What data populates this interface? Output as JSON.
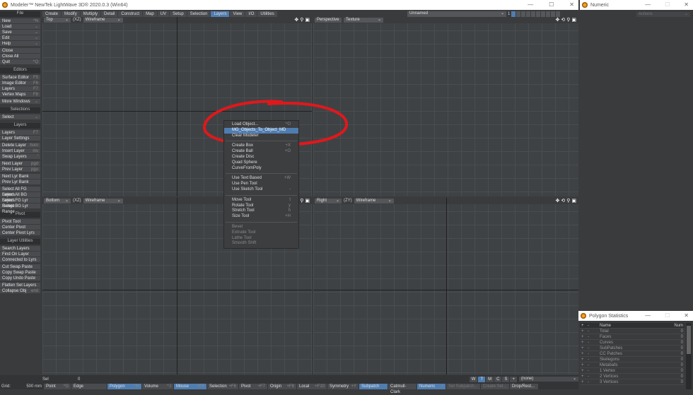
{
  "window": {
    "title": "Modeler™ NewTek LightWave 3D® 2020.0.3 (Win64)",
    "minimize": "—",
    "maximize": "☐",
    "close": "✕"
  },
  "tabs": [
    "Create",
    "Modify",
    "Multiply",
    "Detail",
    "Construct",
    "Map",
    "UV",
    "Setup",
    "Selection",
    "Layers",
    "View",
    "I/O",
    "Utilities"
  ],
  "active_tab": "Layers",
  "layer_bar": {
    "object": "Unnamed",
    "layer_num": "1"
  },
  "sidebar": [
    {
      "header": "File",
      "blocks": [
        [
          {
            "l": "New",
            "s": "^N"
          },
          {
            "l": "Load",
            "s": "⌄"
          },
          {
            "l": "Save",
            "s": "⌄"
          },
          {
            "l": "Edit",
            "s": "⌄"
          },
          {
            "l": "Help",
            "s": "⌄"
          }
        ],
        [
          {
            "l": "Close",
            "s": ""
          },
          {
            "l": "Close All",
            "s": ""
          },
          {
            "l": "Quit",
            "s": "^Q"
          }
        ]
      ]
    },
    {
      "header": "Editors",
      "blocks": [
        [
          {
            "l": "Surface Editor",
            "s": "F5"
          },
          {
            "l": "Image Editor",
            "s": "F6"
          },
          {
            "l": "Layers",
            "s": "F7"
          },
          {
            "l": "Vertex Maps",
            "s": "F8"
          }
        ],
        [
          {
            "l": "More Windows",
            "s": "⌄"
          }
        ]
      ]
    },
    {
      "header": "Selections",
      "blocks": [
        [
          {
            "l": "Select",
            "s": "⌄"
          }
        ]
      ]
    },
    {
      "header": "Layers",
      "blocks": [
        [
          {
            "l": "Layers",
            "s": "F7"
          },
          {
            "l": "Layer Settings",
            "s": ""
          }
        ],
        [
          {
            "l": "Delete Layer",
            "s": "hom"
          },
          {
            "l": "Insert Layer",
            "s": "ins"
          },
          {
            "l": "Swap Layers",
            "s": "'"
          }
        ],
        [
          {
            "l": "Next Layer",
            "s": "pgd"
          },
          {
            "l": "Prev Layer",
            "s": "pgu"
          }
        ],
        [
          {
            "l": "Next Lyr Bank",
            "s": ""
          },
          {
            "l": "Prev Lyr Bank",
            "s": ""
          }
        ],
        [
          {
            "l": "Select All FG Layers",
            "s": ""
          },
          {
            "l": "Select All BG Layers",
            "s": ""
          },
          {
            "l": "Select FG Lyr Range",
            "s": ""
          },
          {
            "l": "Select BG Lyr Range",
            "s": ""
          }
        ]
      ]
    },
    {
      "header": "Pivot",
      "blocks": [
        [
          {
            "l": "Pivot Tool",
            "s": ""
          },
          {
            "l": "Center Pivot",
            "s": ""
          },
          {
            "l": "Center Pivot Lyrs",
            "s": ""
          }
        ]
      ]
    },
    {
      "header": "Layer Utilities",
      "blocks": [
        [
          {
            "l": "Search Layers",
            "s": ""
          },
          {
            "l": "Find On Layer",
            "s": ""
          },
          {
            "l": "Connected to Lyrs",
            "s": ""
          }
        ],
        [
          {
            "l": "Cut Swap Paste",
            "s": ""
          },
          {
            "l": "Copy Swap Paste",
            "s": ""
          },
          {
            "l": "Copy Undo Paste",
            "s": ""
          }
        ],
        [
          {
            "l": "Flatten Sel Layers",
            "s": ""
          },
          {
            "l": "Collapse Obj",
            "s": "end"
          }
        ]
      ]
    }
  ],
  "viewports": [
    {
      "view": "Top",
      "axis": "(XZ)",
      "mode": "Wireframe"
    },
    {
      "view": "Perspective",
      "axis": "",
      "mode": "Texture"
    },
    {
      "view": "Bottom",
      "axis": "(XZ)",
      "mode": "Wireframe"
    },
    {
      "view": "Right",
      "axis": "(ZY)",
      "mode": "Wireframe"
    }
  ],
  "context_menu": [
    [
      {
        "l": "Load Object...",
        "s": "^O"
      },
      {
        "l": "MG_Objects_To_Object_MD",
        "s": "",
        "hl": true
      },
      {
        "l": "Clear Modeler",
        "s": ""
      }
    ],
    [
      {
        "l": "Create Box",
        "s": "+X"
      },
      {
        "l": "Create Ball",
        "s": "+O"
      },
      {
        "l": "Create Disc",
        "s": ""
      },
      {
        "l": "Quad Sphere",
        "s": ""
      },
      {
        "l": "CurveFromPoly",
        "s": ""
      }
    ],
    [
      {
        "l": "Use Text Based",
        "s": "+W"
      },
      {
        "l": "Use Pen Tool",
        "s": ""
      },
      {
        "l": "Use Sketch Tool",
        "s": "-"
      }
    ],
    [
      {
        "l": "Move Tool",
        "s": "t"
      },
      {
        "l": "Rotate Tool",
        "s": "y"
      },
      {
        "l": "Stretch Tool",
        "s": "h"
      },
      {
        "l": "Size Tool",
        "s": "+H"
      }
    ],
    [
      {
        "l": "Bevel",
        "s": "",
        "dim": true
      },
      {
        "l": "Extrude Tool",
        "s": "",
        "dim": true
      },
      {
        "l": "Lathe Tool",
        "s": "",
        "dim": true
      },
      {
        "l": "Smooth Shift",
        "s": "",
        "dim": true
      }
    ]
  ],
  "status": {
    "sel_label": "Sel",
    "sel_value": "0",
    "grid_label": "Grid:",
    "grid_value": "500 mm",
    "wtmcs": [
      "W",
      "T",
      "M",
      "C",
      "S",
      "+"
    ],
    "wtmcs_active": "T",
    "layer_select": "(none)",
    "buttons": [
      {
        "l": "Point",
        "s": "^G"
      },
      {
        "l": "Edge",
        "s": ""
      },
      {
        "l": "Polygon",
        "s": "^H",
        "on": true
      },
      {
        "l": "Volume",
        "s": "^J"
      },
      {
        "l": "Mouse",
        "s": "+F5",
        "on": true
      },
      {
        "l": "Selection",
        "s": "+F6"
      },
      {
        "l": "Pivot",
        "s": "+F7"
      },
      {
        "l": "Origin",
        "s": "+F8"
      },
      {
        "l": "Local",
        "s": "+F10"
      },
      {
        "l": "Symmetry",
        "s": "+Y"
      },
      {
        "l": "Subpatch",
        "s": "",
        "on": true
      },
      {
        "l": "Catmull-Clark",
        "s": ""
      },
      {
        "l": "Numeric",
        "s": "n",
        "on": true
      },
      {
        "l": "Set Subpatch...",
        "s": "",
        "dim": true
      },
      {
        "l": "Create Sel...",
        "s": "",
        "dim": true
      },
      {
        "l": "Drop/Rest...",
        "s": ""
      }
    ]
  },
  "numeric_panel": {
    "title": "Numeric",
    "actions": "Actions"
  },
  "poly_stats": {
    "title": "Polygon Statistics",
    "col_name": "Name",
    "col_num": "Num",
    "rows": [
      {
        "n": "Total",
        "v": "0"
      },
      {
        "n": "Faces",
        "v": "0"
      },
      {
        "n": "Curves",
        "v": "0"
      },
      {
        "n": "SubPatches",
        "v": "0"
      },
      {
        "n": "CC Patches",
        "v": "0"
      },
      {
        "n": "Skelegons",
        "v": "0"
      },
      {
        "n": "Metaballs",
        "v": "0"
      },
      {
        "n": "1 Vertex",
        "v": "0"
      },
      {
        "n": "2 Vertices",
        "v": "0"
      },
      {
        "n": "3 Vertices",
        "v": "0"
      }
    ]
  },
  "colors": {
    "accent": "#4f7db0",
    "annotation": "#e0181b"
  }
}
